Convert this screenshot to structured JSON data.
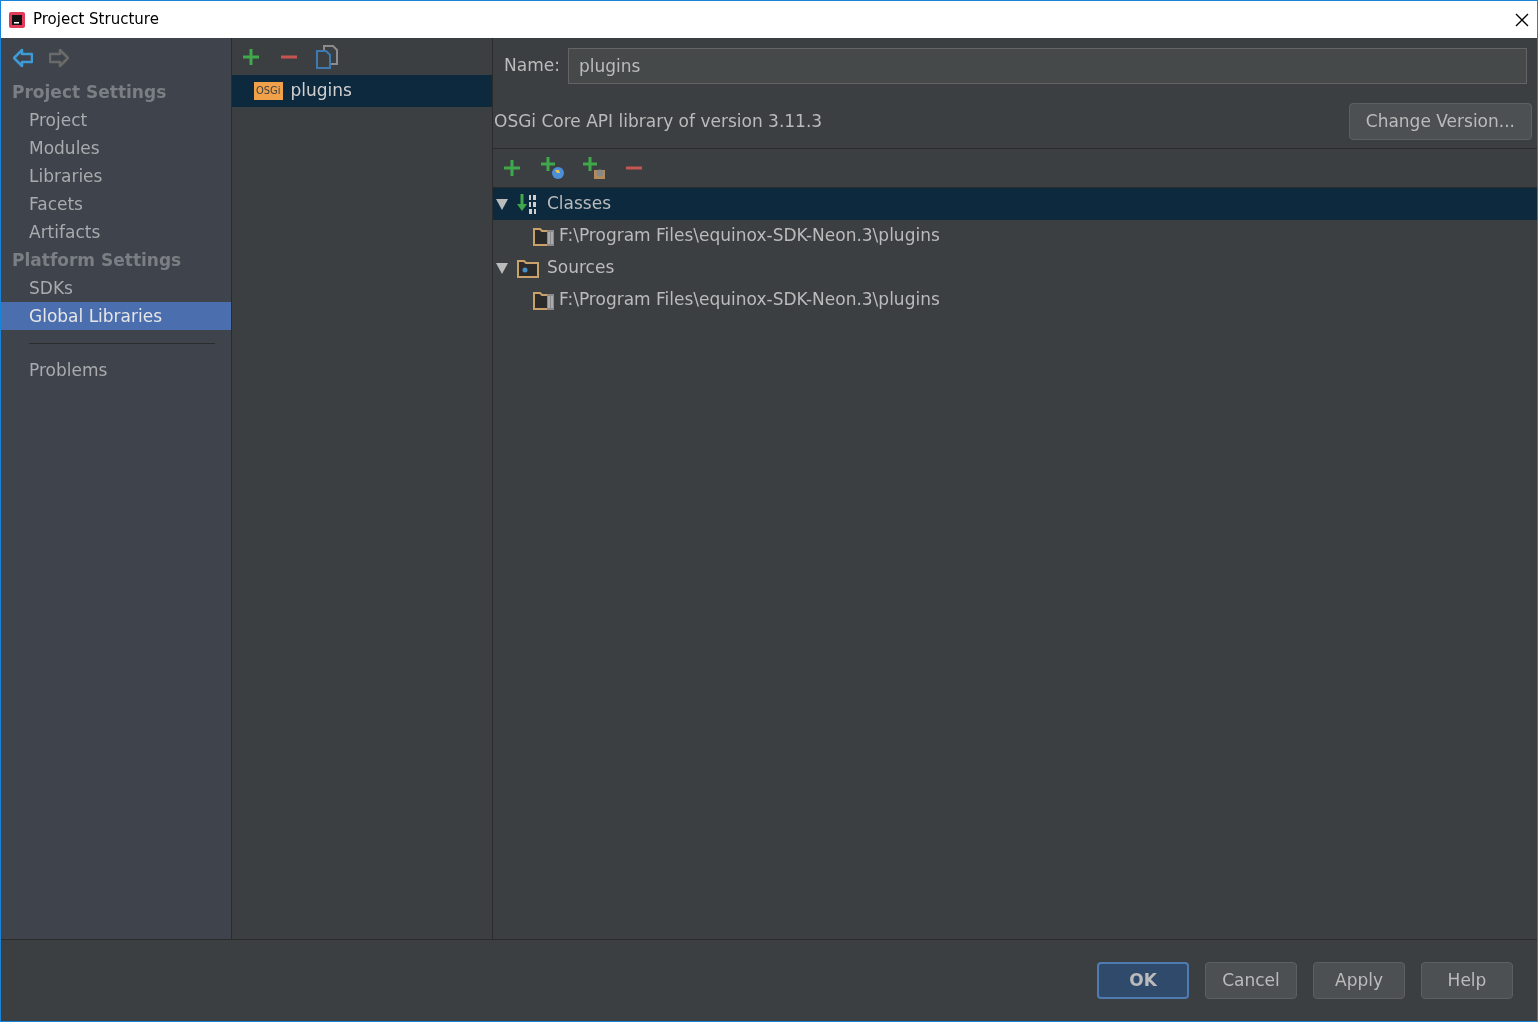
{
  "window": {
    "title": "Project Structure"
  },
  "navigation": {
    "back_enabled": true,
    "forward_enabled": false
  },
  "sidebar": {
    "sections": [
      {
        "heading": "Project Settings",
        "items": [
          {
            "label": "Project",
            "selected": false
          },
          {
            "label": "Modules",
            "selected": false
          },
          {
            "label": "Libraries",
            "selected": false
          },
          {
            "label": "Facets",
            "selected": false
          },
          {
            "label": "Artifacts",
            "selected": false
          }
        ]
      },
      {
        "heading": "Platform Settings",
        "items": [
          {
            "label": "SDKs",
            "selected": false
          },
          {
            "label": "Global Libraries",
            "selected": true
          }
        ]
      }
    ],
    "bottom_items": [
      {
        "label": "Problems",
        "selected": false
      }
    ]
  },
  "library_list": {
    "items": [
      {
        "badge": "OSGi",
        "label": "plugins",
        "selected": true
      }
    ]
  },
  "details": {
    "name_label": "Name:",
    "name_value": "plugins",
    "description": "OSGi Core API library of version 3.11.3",
    "change_version_button": "Change Version...",
    "roots": [
      {
        "kind": "classes",
        "label": "Classes",
        "expanded": true,
        "selected": true,
        "children": [
          {
            "label": "F:\\Program Files\\equinox-SDK-Neon.3\\plugins"
          }
        ]
      },
      {
        "kind": "sources",
        "label": "Sources",
        "expanded": true,
        "selected": false,
        "children": [
          {
            "label": "F:\\Program Files\\equinox-SDK-Neon.3\\plugins"
          }
        ]
      }
    ]
  },
  "buttons": [
    {
      "label": "OK",
      "default": true
    },
    {
      "label": "Cancel",
      "default": false
    },
    {
      "label": "Apply",
      "default": false
    },
    {
      "label": "Help",
      "default": false
    }
  ]
}
